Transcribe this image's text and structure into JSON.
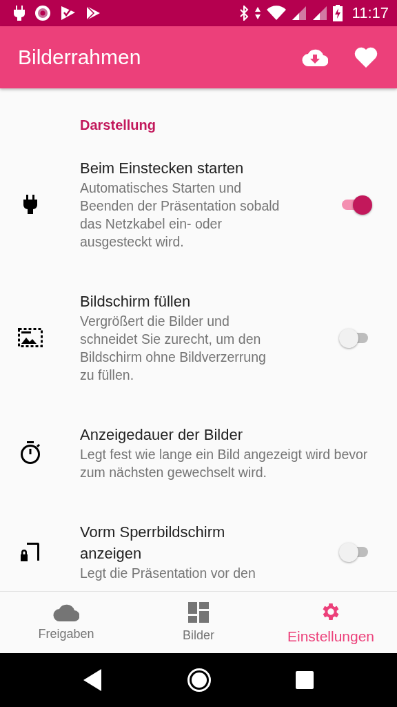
{
  "status_bar": {
    "time": "11:17"
  },
  "app_bar": {
    "title": "Bilderrahmen"
  },
  "section": {
    "title": "Darstellung"
  },
  "settings": [
    {
      "kind": "switch",
      "title": "Beim Einstecken starten",
      "description": "Automatisches Starten und Beenden der Präsentation sobald das Netzkabel ein- oder ausgesteckt wird.",
      "on": true
    },
    {
      "kind": "switch",
      "title": "Bildschirm füllen",
      "description": "Vergrößert die Bilder und schneidet Sie zurecht, um den Bildschirm ohne Bildverzerrung zu füllen.",
      "on": false
    },
    {
      "kind": "plain",
      "title": "Anzeigedauer der Bilder",
      "description": "Legt fest wie lange ein Bild angezeigt wird bevor zum nächsten gewechselt wird."
    },
    {
      "kind": "switch",
      "title": "Vorm Sperrbildschirm anzeigen",
      "description": "Legt die Präsentation vor den",
      "on": false
    }
  ],
  "bottom_nav": [
    {
      "label": "Freigaben",
      "selected": false
    },
    {
      "label": "Bilder",
      "selected": false
    },
    {
      "label": "Einstellungen",
      "selected": true
    }
  ]
}
